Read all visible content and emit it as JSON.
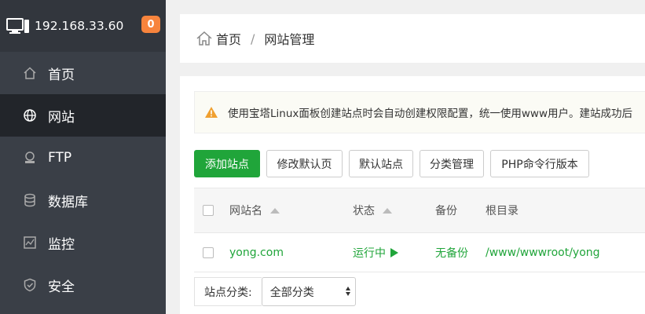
{
  "sidebar": {
    "ip": "192.168.33.60",
    "badge": "0",
    "items": [
      {
        "label": "首页",
        "icon": "home-icon"
      },
      {
        "label": "网站",
        "icon": "globe-icon"
      },
      {
        "label": "FTP",
        "icon": "ftp-icon"
      },
      {
        "label": "数据库",
        "icon": "database-icon"
      },
      {
        "label": "监控",
        "icon": "monitor-chart-icon"
      },
      {
        "label": "安全",
        "icon": "shield-icon"
      }
    ]
  },
  "breadcrumb": {
    "home": "首页",
    "separator": "/",
    "current": "网站管理"
  },
  "alert": {
    "text": "使用宝塔Linux面板创建站点时会自动创建权限配置，统一使用www用户。建站成功后"
  },
  "toolbar": {
    "add_site": "添加站点",
    "edit_default_page": "修改默认页",
    "default_site": "默认站点",
    "category_manage": "分类管理",
    "php_cli_version": "PHP命令行版本"
  },
  "table": {
    "headers": {
      "name": "网站名",
      "status": "状态",
      "backup": "备份",
      "root": "根目录"
    },
    "rows": [
      {
        "name": "yong.com",
        "status": "运行中",
        "backup": "无备份",
        "root": "/www/wwwroot/yong"
      }
    ]
  },
  "filter": {
    "label": "站点分类:",
    "selected": "全部分类"
  },
  "colors": {
    "accent": "#20a53a",
    "sidebar_bg": "#3a3f47",
    "badge": "#f7843d"
  }
}
